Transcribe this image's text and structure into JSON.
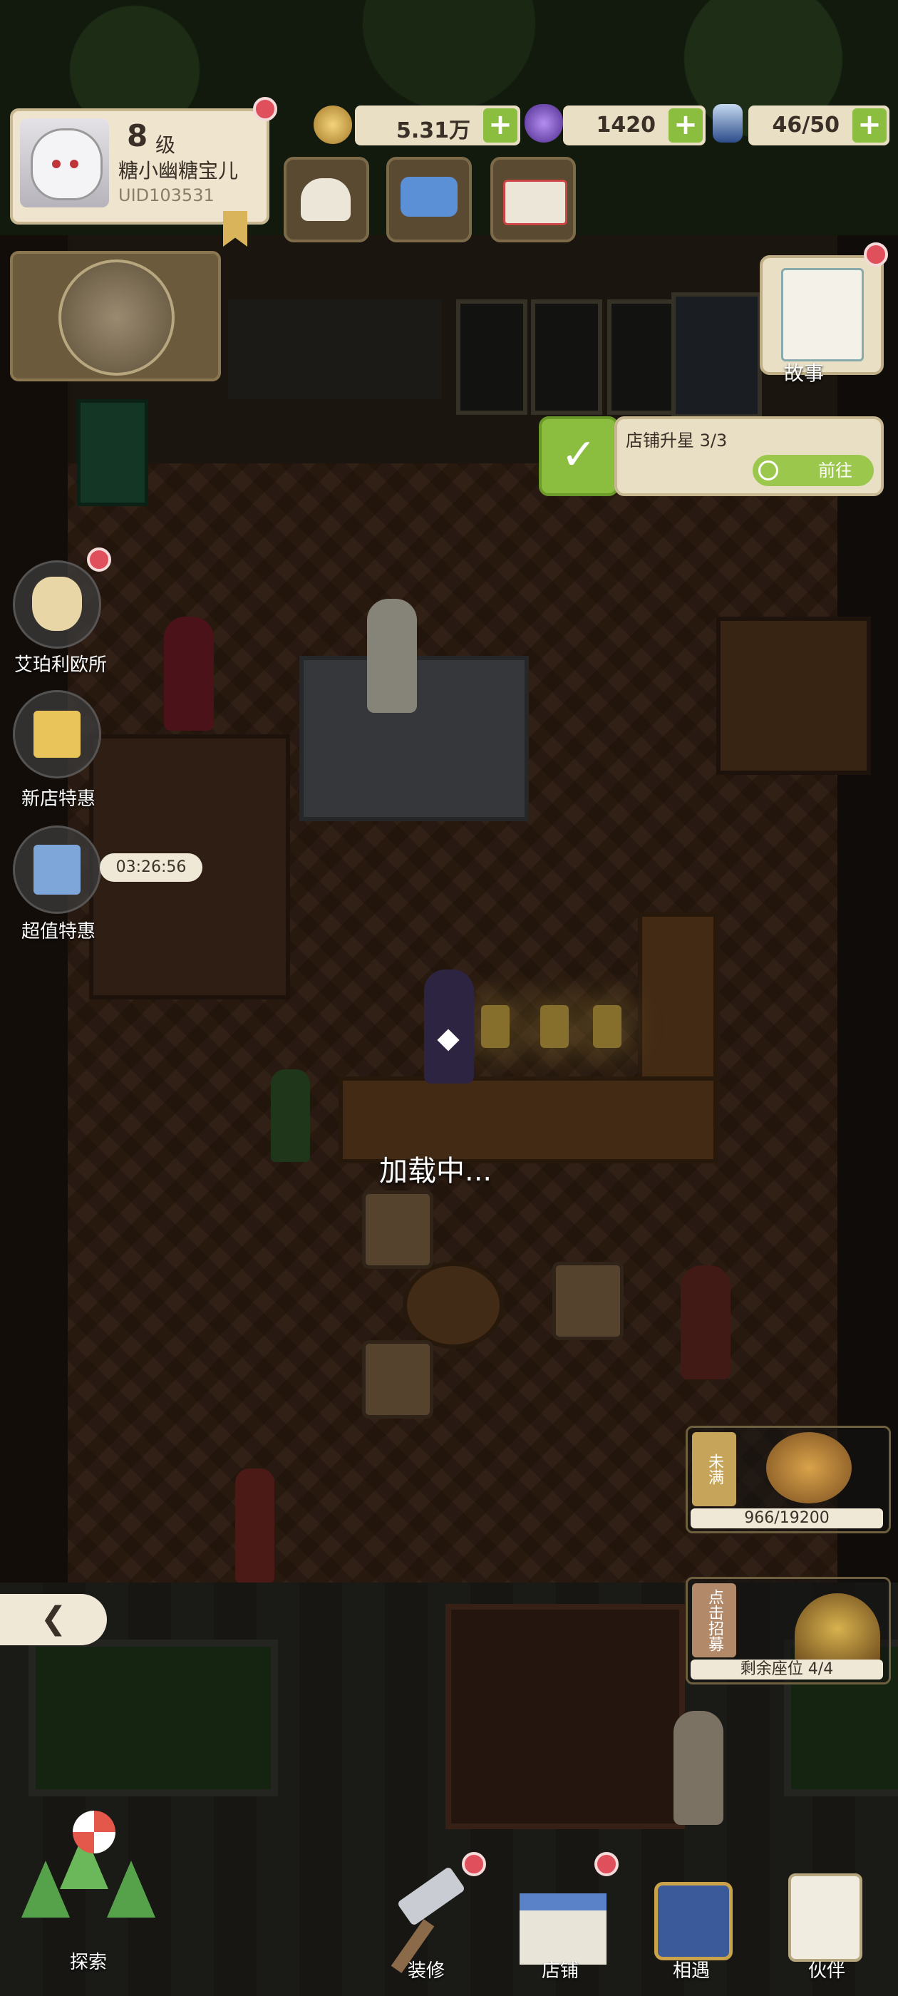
{
  "profile": {
    "level_num": "8",
    "level_unit": "级",
    "name": "糖小幽糖宝儿",
    "uid": "UID103531"
  },
  "resources": {
    "gold": {
      "icon": "gold-coin-icon",
      "value": "5.31万",
      "plus": "+"
    },
    "gem": {
      "icon": "purple-egg-icon",
      "value": "1420",
      "plus": "+"
    },
    "energy": {
      "icon": "bottle-icon",
      "value": "46/50",
      "plus": "+"
    }
  },
  "top_buttons": [
    "cats-icon",
    "chat-icon",
    "mail-icon"
  ],
  "story": {
    "label": "故事",
    "icon": "story-book-icon"
  },
  "quest": {
    "title": "店铺升星 3/3",
    "go_label": "前往"
  },
  "side_menu": {
    "aipaliou": "艾珀利欧所",
    "new_shop_deal": "新店特惠",
    "super_deal": "超值特惠",
    "timer": "03:26:56"
  },
  "loading_text": "加载中...",
  "cards": {
    "unfilled": {
      "tag": "未满",
      "progress": "966/19200",
      "fill_fraction": 0.05
    },
    "recruit": {
      "tag": "点击招募",
      "seats": "剩余座位 4/4"
    }
  },
  "back_tab": "❮",
  "bottom_nav": {
    "explore": "探索",
    "decorate": "装修",
    "shop": "店铺",
    "meet": "相遇",
    "partner": "伙伴"
  },
  "colors": {
    "accent_green": "#8bbd3f",
    "badge_red": "#e04f5c",
    "panel_cream": "#e8dfc5"
  }
}
